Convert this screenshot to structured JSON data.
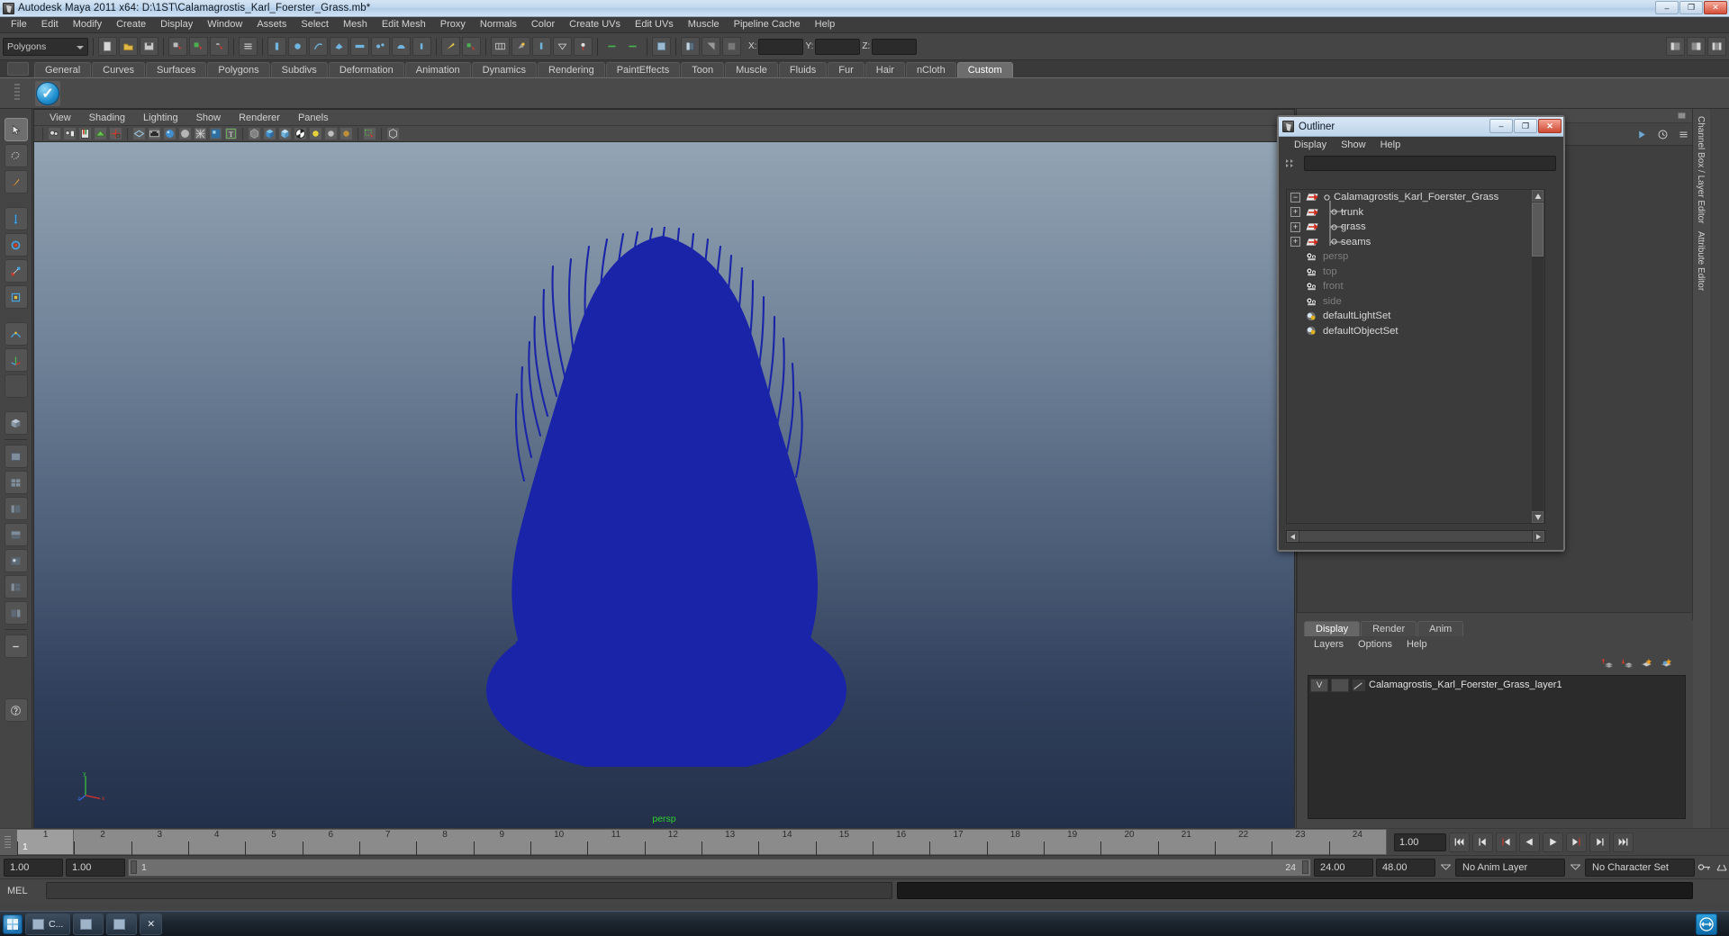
{
  "window": {
    "title": "Autodesk Maya 2011 x64: D:\\1ST\\Calamagrostis_Karl_Foerster_Grass.mb*",
    "min_label": "–",
    "max_label": "❐",
    "close_label": "✕",
    "app_icon": "maya-icon"
  },
  "menubar": {
    "items": [
      "File",
      "Edit",
      "Modify",
      "Create",
      "Display",
      "Window",
      "Assets",
      "Select",
      "Mesh",
      "Edit Mesh",
      "Proxy",
      "Normals",
      "Color",
      "Create UVs",
      "Edit UVs",
      "Muscle",
      "Pipeline Cache",
      "Help"
    ]
  },
  "statusline": {
    "mode_selector": "Polygons",
    "axis_labels": [
      "X:",
      "Y:",
      "Z:"
    ],
    "axis_values": [
      "",
      "",
      ""
    ]
  },
  "shelf": {
    "tabs": [
      "General",
      "Curves",
      "Surfaces",
      "Polygons",
      "Subdivs",
      "Deformation",
      "Animation",
      "Dynamics",
      "Rendering",
      "PaintEffects",
      "Toon",
      "Muscle",
      "Fluids",
      "Fur",
      "Hair",
      "nCloth",
      "Custom"
    ],
    "active_tab": "Custom",
    "icon_name": "blue-check-shelf-icon"
  },
  "viewport": {
    "menus": [
      "View",
      "Shading",
      "Lighting",
      "Show",
      "Renderer",
      "Panels"
    ],
    "camera_label": "persp",
    "axis_x": "x",
    "axis_y": "y",
    "axis_z": "z",
    "object_color": "#1a24a8"
  },
  "outliner": {
    "title": "Outliner",
    "min_label": "–",
    "max_label": "❐",
    "close_label": "✕",
    "menus": [
      "Display",
      "Show",
      "Help"
    ],
    "search_value": "",
    "items": [
      {
        "label": "Calamagrostis_Karl_Foerster_Grass",
        "expander": "−",
        "depth": 0,
        "icon": "transform-icon",
        "dim": false
      },
      {
        "label": "trunk",
        "expander": "+",
        "depth": 1,
        "icon": "transform-icon",
        "dim": false
      },
      {
        "label": "grass",
        "expander": "+",
        "depth": 1,
        "icon": "transform-icon",
        "dim": false
      },
      {
        "label": "seams",
        "expander": "+",
        "depth": 1,
        "icon": "transform-icon",
        "dim": false
      },
      {
        "label": "persp",
        "expander": "",
        "depth": 1,
        "icon": "camera-icon",
        "dim": true
      },
      {
        "label": "top",
        "expander": "",
        "depth": 1,
        "icon": "camera-icon",
        "dim": true
      },
      {
        "label": "front",
        "expander": "",
        "depth": 1,
        "icon": "camera-icon",
        "dim": true
      },
      {
        "label": "side",
        "expander": "",
        "depth": 1,
        "icon": "camera-icon",
        "dim": true
      },
      {
        "label": "defaultLightSet",
        "expander": "",
        "depth": 1,
        "icon": "set-icon",
        "dim": false
      },
      {
        "label": "defaultObjectSet",
        "expander": "",
        "depth": 1,
        "icon": "set-icon",
        "dim": false
      }
    ]
  },
  "layer_editor": {
    "tabs": [
      "Display",
      "Render",
      "Anim"
    ],
    "active_tab": "Display",
    "menus": [
      "Layers",
      "Options",
      "Help"
    ],
    "layers": [
      {
        "visibility": "V",
        "state": "",
        "name": "Calamagrostis_Karl_Foerster_Grass_layer1"
      }
    ]
  },
  "right_dock": {
    "vertical_tabs": [
      "Channel Box / Layer Editor",
      "Attribute Editor"
    ]
  },
  "timeline": {
    "ticks": [
      1,
      2,
      3,
      4,
      5,
      6,
      7,
      8,
      9,
      10,
      11,
      12,
      13,
      14,
      15,
      16,
      17,
      18,
      19,
      20,
      21,
      22,
      23,
      24
    ],
    "current_frame": "1",
    "current_time_field": "1.00",
    "playback_buttons": [
      "go-to-start",
      "step-back-key",
      "step-back-frame",
      "play-backwards",
      "play-forwards",
      "step-forward-frame",
      "step-forward-key",
      "go-to-end"
    ]
  },
  "range": {
    "anim_start": "1.00",
    "range_start": "1.00",
    "slider_start": "1",
    "slider_end": "24",
    "range_end": "24.00",
    "anim_end": "48.00",
    "anim_layer": "No Anim Layer",
    "character_set": "No Character Set"
  },
  "mel": {
    "label": "MEL",
    "input_value": "",
    "output_value": ""
  },
  "taskbar": {
    "start_label": "start-orb",
    "items": [
      {
        "label": "C...",
        "icon": "window-icon"
      },
      {
        "label": "",
        "icon": "window-icon"
      },
      {
        "label": "",
        "icon": "window-icon"
      },
      {
        "label": "✕",
        "icon": "close-window-icon"
      }
    ],
    "tray_icon": "teamviewer-icon"
  }
}
